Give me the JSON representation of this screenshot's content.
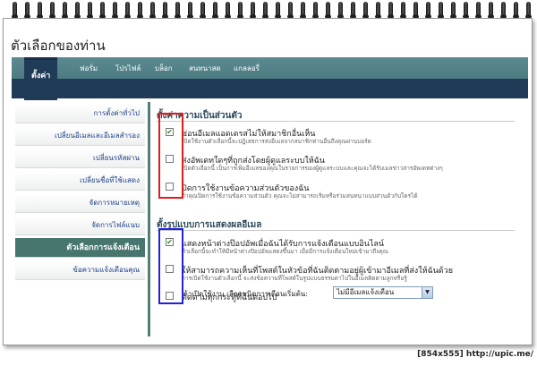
{
  "page": {
    "title": "ตัวเลือกของท่าน",
    "footer": "[854x555] http://upic.me/"
  },
  "tabs": [
    {
      "label": "ตั้งค่า",
      "active": true
    },
    {
      "label": "ฟอรั่ม"
    },
    {
      "label": "โปรไฟล์"
    },
    {
      "label": "บล็อก"
    },
    {
      "label": "สนทนาสด"
    },
    {
      "label": "แกลลอรี่"
    }
  ],
  "sidebar": {
    "items": [
      {
        "label": "การตั้งค่าทั่วไป"
      },
      {
        "label": "เปลี่ยนอีเมลและอีเมลสำรอง"
      },
      {
        "label": "เปลี่ยนรหัสผ่าน"
      },
      {
        "label": "เปลี่ยนชื่อที่ใช้แสดง"
      },
      {
        "label": "จัดการหมายเหตุ"
      },
      {
        "label": "จัดการไฟล์แนบ"
      },
      {
        "label": "ตัวเลือกการแจ้งเตือน",
        "active": true
      },
      {
        "label": "ข้อความแจ้งเตือนคุณ"
      }
    ]
  },
  "privacy": {
    "title": "ตั้งค่าความเป็นส่วนตัว",
    "options": [
      {
        "label": "ซ่อนอีเมลแอดเดรสไม่ให้สมาชิกอื่นเห็น",
        "desc": "เปิดใช้งานตัวเลือกนี้จะปฏิเสธการส่งอีเมลจากสมาชิกท่านอื่นถึงคุณผ่านบอร์ด",
        "checked": true
      },
      {
        "label": "ส่งอัพเดทใดๆที่ถูกส่งโดยผู้ดูแลระบบให้ฉัน",
        "desc": "เปิดตัวเลือกนี้ เป็นการเพิ่มอีเมลของคุณในรายการของผู้ดูแลระบบและคุณจะได้รับเมลข่าวสารอัพเดทต่างๆ",
        "checked": false
      },
      {
        "label": "ปิดการใช้งานข้อความส่วนตัวของฉัน",
        "desc": "ถ้าคุณปิดการใช้งานข้อความส่วนตัว คุณจะไม่สามารถเริ่มหรือร่วมสนทนาแบบส่วนตัวกับใครได้",
        "checked": false
      }
    ]
  },
  "display": {
    "title": "ตั้งรูปแบบการแสดงผลอีเมล",
    "options": [
      {
        "label": "แสดงหน้าต่างป๊อปอัพเมื่อฉันได้รับการแจ้งเตือนแบบอินไลน์",
        "desc": "ตัวเลือกนี้จะทำให้มีหน้าต่างป๊อปอัพแสดงขึ้นมา เมื่อมีการแจ้งเตือนใหม่เข้ามาถึงคุณ",
        "checked": true
      },
      {
        "label": "ให้สามารถความเห็นที่โพสต์ในหัวข้อที่ฉันติดตามอยู่ผู้เข้ามาอีเมลที่ส่งให้ฉันด้วย",
        "desc": "การเปิดใช้งานตัวเลือกนี้ จะส่งข้อความที่โพสต์ในรูปแบบธรรมดาไปในอีเมลติดตามลูกหรือรู้",
        "checked": false
      },
      {
        "label": "ติดตามทุกกระทู้ที่ฉันตอบไป",
        "desc": "",
        "checked": false
      }
    ],
    "notify_label": "ถ้าเปิดใช้งาน เลือกชนิดการเตือนเริ่มต้น:",
    "notify_value": "ไม่มีอีเมลแจ้งเตือน"
  },
  "colors": {
    "accent": "#47766e",
    "tabbar": "#203b57",
    "highlight_red": "#e21b1b",
    "highlight_blue": "#2222dd"
  }
}
